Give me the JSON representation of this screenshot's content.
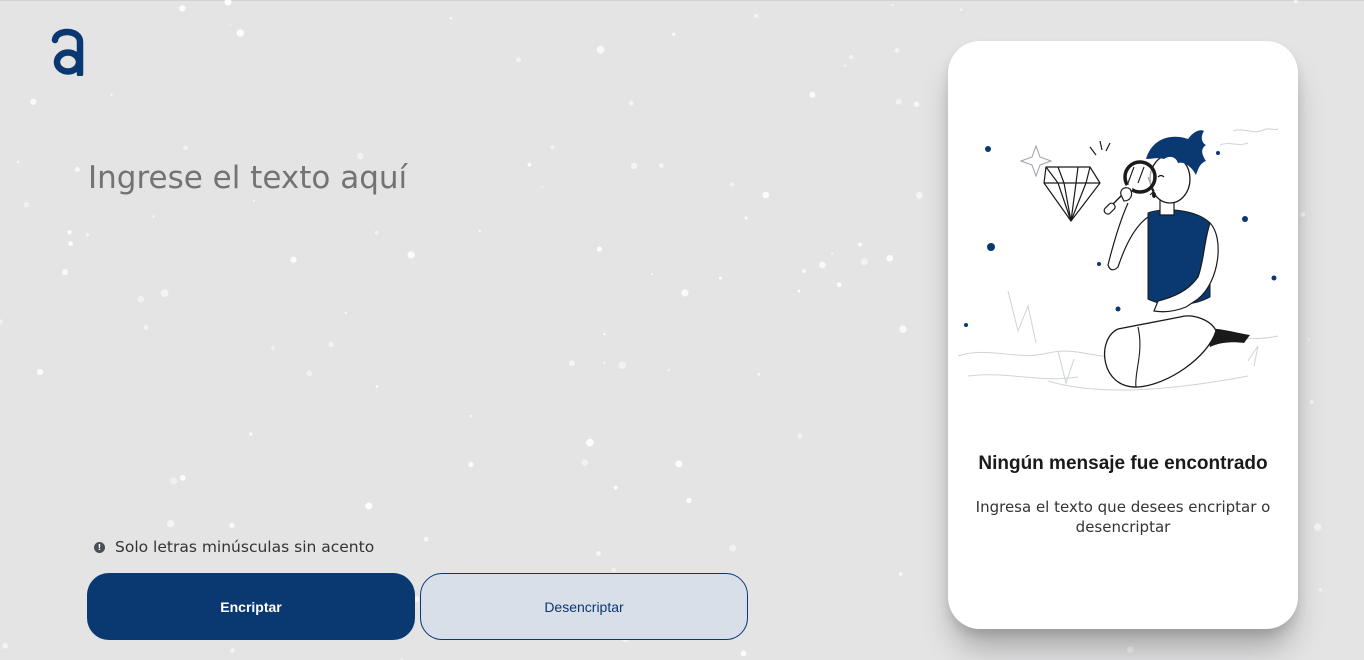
{
  "colors": {
    "background": "#e4e4e5",
    "primary": "#0a3871",
    "secondary_button_bg": "#d8dfe8",
    "card": "#ffffff"
  },
  "logo": {
    "icon": "alura-a-logo-icon"
  },
  "input": {
    "placeholder": "Ingrese el texto aquí",
    "value": ""
  },
  "hint": {
    "icon": "info-icon",
    "text": "Solo letras minúsculas sin acento"
  },
  "buttons": {
    "encrypt": "Encriptar",
    "decrypt": "Desencriptar"
  },
  "output_card": {
    "illustration": "person-with-magnifying-glass-illustration",
    "title": "Ningún mensaje fue encontrado",
    "text": "Ingresa el texto que desees encriptar o desencriptar"
  }
}
